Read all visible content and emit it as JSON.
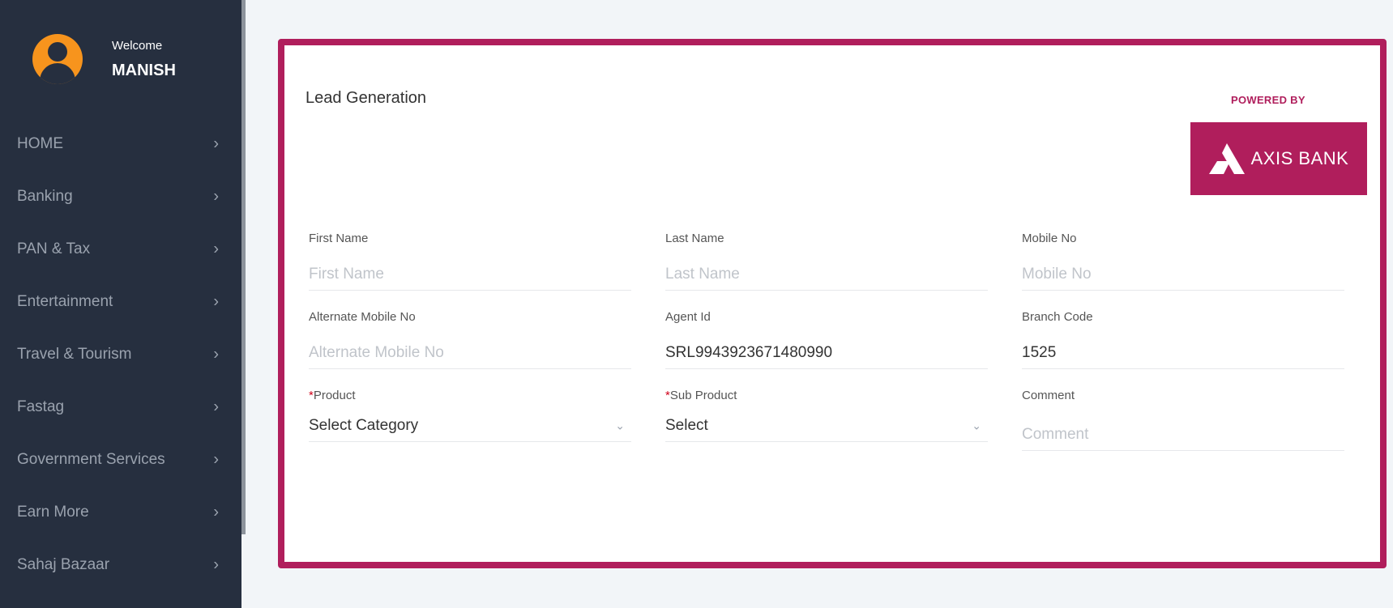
{
  "user": {
    "welcome": "Welcome",
    "name": "MANISH"
  },
  "nav": [
    {
      "label": "HOME"
    },
    {
      "label": "Banking"
    },
    {
      "label": "PAN & Tax"
    },
    {
      "label": "Entertainment"
    },
    {
      "label": "Travel & Tourism"
    },
    {
      "label": "Fastag"
    },
    {
      "label": "Government Services"
    },
    {
      "label": "Earn More"
    },
    {
      "label": "Sahaj Bazaar"
    }
  ],
  "chevron": "›",
  "form": {
    "title": "Lead Generation",
    "powered_by": "POWERED BY",
    "brand": "AXIS BANK",
    "first_name": {
      "label": "First Name",
      "placeholder": "First Name"
    },
    "last_name": {
      "label": "Last Name",
      "placeholder": "Last Name"
    },
    "mobile": {
      "label": "Mobile No",
      "placeholder": "Mobile No"
    },
    "alt_mobile": {
      "label": "Alternate Mobile No",
      "placeholder": "Alternate Mobile No"
    },
    "agent_id": {
      "label": "Agent Id",
      "value": "SRL9943923671480990"
    },
    "branch_code": {
      "label": "Branch Code",
      "value": "1525"
    },
    "product": {
      "required_mark": "*",
      "label": "Product",
      "value": "Select Category"
    },
    "sub_product": {
      "required_mark": "*",
      "label": "Sub Product",
      "value": "Select"
    },
    "comment": {
      "label": "Comment",
      "placeholder": "Comment"
    }
  },
  "colors": {
    "sidebar": "#262f3f",
    "accent": "#b01e5c",
    "avatar": "#f7941d"
  },
  "icons": {
    "avatar": "user-avatar-icon",
    "logo": "axis-bank-logo-icon",
    "dropdown": "chevron-down-icon",
    "nav_arrow": "chevron-right-icon"
  }
}
